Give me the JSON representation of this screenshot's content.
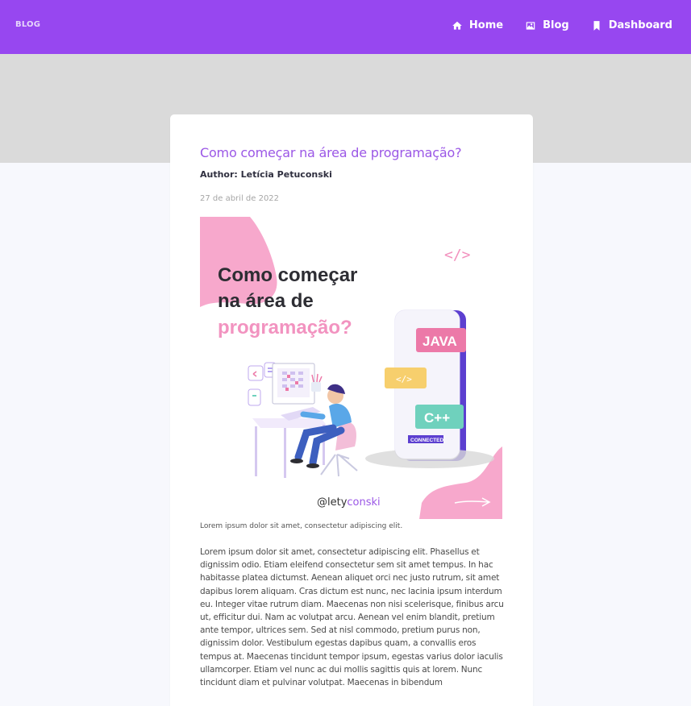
{
  "nav": {
    "brand": "BLOG",
    "items": [
      {
        "label": "Home",
        "icon": "home-icon"
      },
      {
        "label": "Blog",
        "icon": "image-icon"
      },
      {
        "label": "Dashboard",
        "icon": "bookmark-icon"
      }
    ]
  },
  "post": {
    "title": "Como começar na área de programação?",
    "author": "Author: Letícia Petuconski",
    "date": "27 de abril de 2022",
    "caption": "Lorem ipsum dolor sit amet, consectetur adipiscing elit.",
    "body": "Lorem ipsum dolor sit amet, consectetur adipiscing elit. Phasellus et dignissim odio. Etiam eleifend consectetur sem sit amet tempus. In hac habitasse platea dictumst. Aenean aliquet orci nec justo rutrum, sit amet dapibus lorem aliquam. Cras dictum est nunc, nec lacinia ipsum interdum eu. Integer vitae rutrum diam. Maecenas non nisi scelerisque, finibus arcu ut, efficitur dui. Nam ac volutpat arcu. Aenean vel enim blandit, pretium ante tempor, ultrices sem. Sed at nisl commodo, pretium purus non, dignissim dolor. Vestibulum egestas dapibus quam, a convallis eros tempus at. Maecenas tincidunt tempor ipsum, egestas varius dolor iaculis ullamcorper. Etiam vel nunc ac dui mollis sagittis quis at lorem. Nunc tincidunt diam et pulvinar volutpat. Maecenas in bibendum"
  },
  "cover": {
    "heading_line1": "Como começar",
    "heading_line2": "na área de",
    "heading_line3": "programação?",
    "code_tag": "</>",
    "badge_java": "JAVA",
    "badge_code": "</>",
    "badge_cpp": "C++",
    "phone_status": "CONNECTED",
    "handle_prefix": "@lety",
    "handle_suffix": "conski"
  },
  "colors": {
    "navbar": "#9747f0",
    "title": "#9b57e6",
    "pink": "#f7a8cc",
    "java_badge": "#ec79a8",
    "cpp_badge": "#6fd1bd",
    "code_badge": "#f7cf6d"
  }
}
